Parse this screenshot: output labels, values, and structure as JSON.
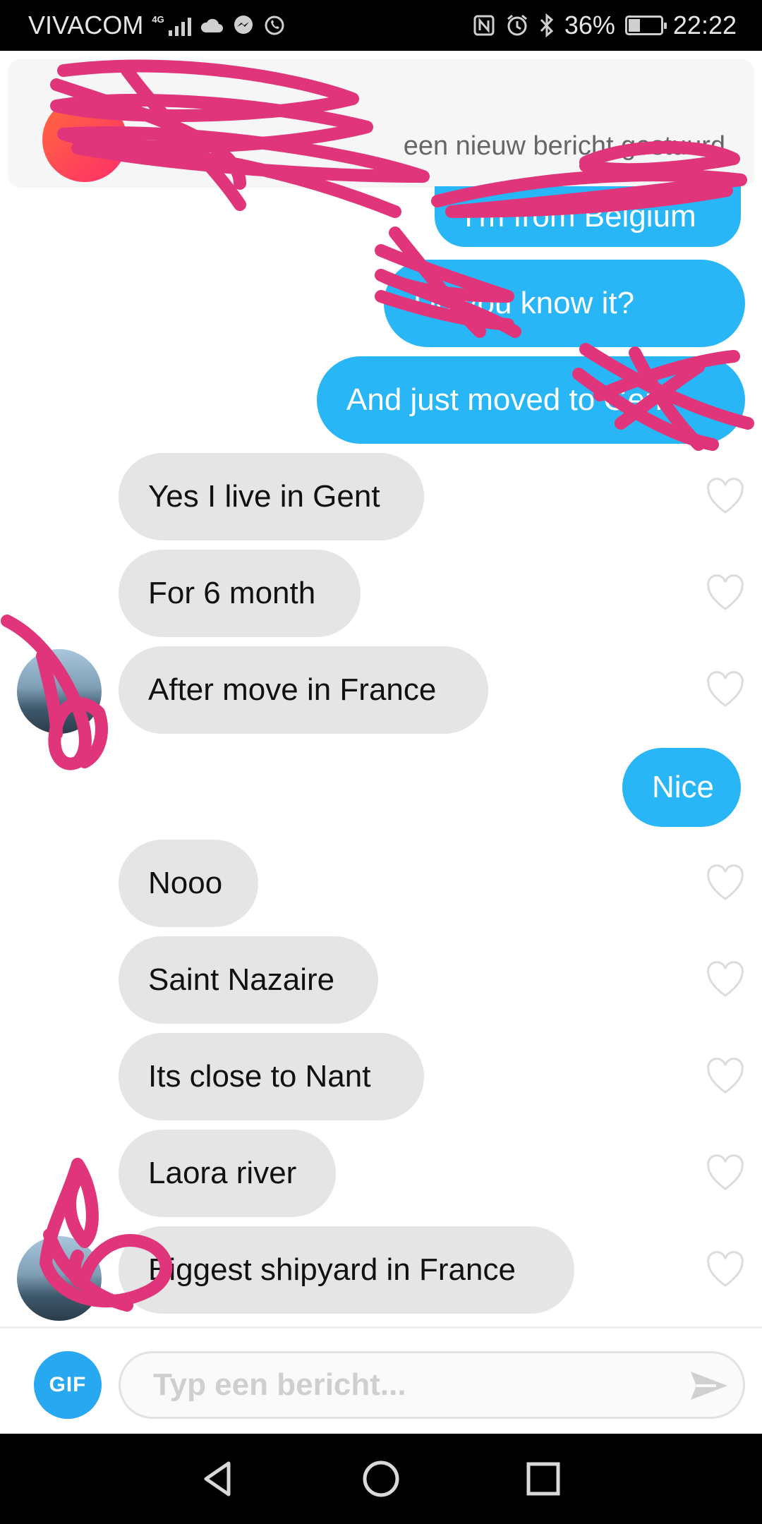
{
  "status_bar": {
    "carrier": "VIVACOM",
    "network_type": "4G",
    "battery_percent": "36%",
    "battery_level": 0.36,
    "time": "22:22",
    "icons": [
      "signal-icon",
      "cloud-icon",
      "messenger-icon",
      "whatsapp-icon",
      "nfc-icon",
      "alarm-icon",
      "bluetooth-icon",
      "battery-icon"
    ]
  },
  "notification": {
    "text": "een nieuw bericht gestuurd"
  },
  "messages": [
    {
      "side": "out",
      "text": "I'm from Belgium"
    },
    {
      "side": "out",
      "text": "Do you know it?"
    },
    {
      "side": "out",
      "text": "And just moved to Gent"
    },
    {
      "side": "in",
      "text": "Yes I live in Gent"
    },
    {
      "side": "in",
      "text": "For 6 month"
    },
    {
      "side": "in",
      "text": "After move in France"
    },
    {
      "side": "out",
      "text": "Nice"
    },
    {
      "side": "in",
      "text": "Nooo"
    },
    {
      "side": "in",
      "text": "Saint Nazaire"
    },
    {
      "side": "in",
      "text": "Its close to Nant"
    },
    {
      "side": "in",
      "text": "Laora river"
    },
    {
      "side": "in",
      "text": "Biggest shipyard in France"
    }
  ],
  "composer": {
    "gif_label": "GIF",
    "placeholder": "Typ een bericht..."
  },
  "colors": {
    "outgoing_bubble": "#29b6f6",
    "incoming_bubble": "#e5e5e5",
    "gif_button": "#29a8f2",
    "redaction": "#e0357a"
  }
}
